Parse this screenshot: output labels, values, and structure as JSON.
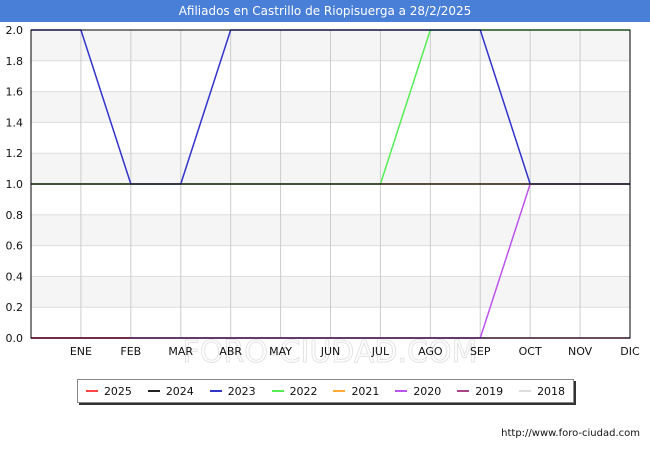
{
  "title": "Afiliados en Castrillo de Riopisuerga a 28/2/2025",
  "watermark": "FORO-CIUDAD.COM",
  "source": "http://www.foro-ciudad.com",
  "chart_data": {
    "type": "line",
    "title": "Afiliados en Castrillo de Riopisuerga a 28/2/2025",
    "categories": [
      "",
      "ENE",
      "FEB",
      "MAR",
      "ABR",
      "MAY",
      "JUN",
      "JUL",
      "AGO",
      "SEP",
      "OCT",
      "NOV",
      "DIC"
    ],
    "ylim": [
      0,
      2
    ],
    "yticks": [
      "0.0",
      "0.2",
      "0.4",
      "0.6",
      "0.8",
      "1.0",
      "1.2",
      "1.4",
      "1.6",
      "1.8",
      "2.0"
    ],
    "grid": true,
    "legend_position": "bottom",
    "series": [
      {
        "name": "2025",
        "color": "#ff4444",
        "values": [
          0,
          0,
          0
        ]
      },
      {
        "name": "2024",
        "color": "#222222",
        "values": [
          1,
          1,
          1,
          1,
          1,
          1,
          1,
          1,
          1,
          1,
          1,
          1,
          1
        ]
      },
      {
        "name": "2023",
        "color": "#3333cc",
        "values": [
          2,
          2,
          1,
          1,
          2,
          2,
          2,
          2,
          2,
          2,
          1,
          1,
          1
        ]
      },
      {
        "name": "2022",
        "color": "#55ee55",
        "values": [
          1,
          1,
          1,
          1,
          1,
          1,
          1,
          1,
          2,
          2,
          2,
          2,
          2
        ]
      },
      {
        "name": "2021",
        "color": "#ffaa33",
        "values": [
          1,
          1,
          1,
          1,
          1,
          1,
          1,
          1,
          1,
          1,
          1,
          1,
          1
        ]
      },
      {
        "name": "2020",
        "color": "#bb55ee",
        "values": [
          0,
          0,
          0,
          0,
          0,
          0,
          0,
          0,
          0,
          0,
          1,
          1,
          1
        ]
      },
      {
        "name": "2019",
        "color": "#aa4488",
        "values": [
          0,
          0,
          0,
          0,
          0,
          0,
          0,
          0,
          0,
          0,
          0,
          0,
          0
        ]
      },
      {
        "name": "2018",
        "color": "#dddddd",
        "values": [
          0,
          0,
          0,
          0,
          0,
          0,
          0,
          0,
          0,
          0,
          0,
          0,
          0
        ]
      }
    ]
  }
}
